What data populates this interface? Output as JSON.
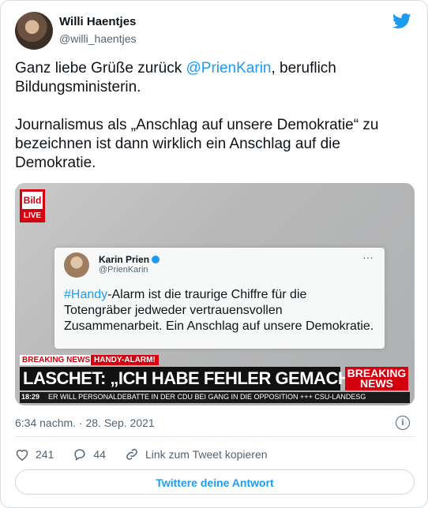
{
  "author": {
    "name": "Willi Haentjes",
    "handle": "@willi_haentjes"
  },
  "tweet": {
    "text_before": "Ganz liebe Grüße zurück ",
    "mention": "@PrienKarin",
    "text_after": ", beruflich\nBildungsministerin.\n\nJournalismus als „Anschlag auf unsere Demokratie“ zu\nbezeichnen ist dann wirklich ein Anschlag auf die\nDemokratie."
  },
  "media": {
    "logo": "Bild",
    "live": "LIVE",
    "inner_tweet": {
      "name": "Karin Prien",
      "handle": "@PrienKarin",
      "text_hashtag": "#Handy",
      "text": "-Alarm ist die traurige Chiffre für die\nTotengräber jedweder vertrauensvollen\nZusammenarbeit. Ein Anschlag auf unsere Demokratie."
    },
    "breaking_label": "BREAKING NEWS",
    "topic_label": "HANDY-ALARM!",
    "headline": "LASCHET: „ICH HABE FEHLER GEMACHT“",
    "logo_breaking": "BREAKING\nNEWS",
    "time": "18:29",
    "crawl": "ER WILL PERSONALDEBATTE IN DER CDU BEI GANG IN DIE OPPOSITION +++ CSU-LANDESG"
  },
  "timestamp": "6:34 nachm. · 28. Sep. 2021",
  "actions": {
    "likes": "241",
    "replies": "44",
    "copy_link": "Link zum Tweet kopieren"
  },
  "reply_button": "Twittere deine Antwort",
  "colors": {
    "accent": "#1d9bf0",
    "bild_red": "#d40010"
  }
}
